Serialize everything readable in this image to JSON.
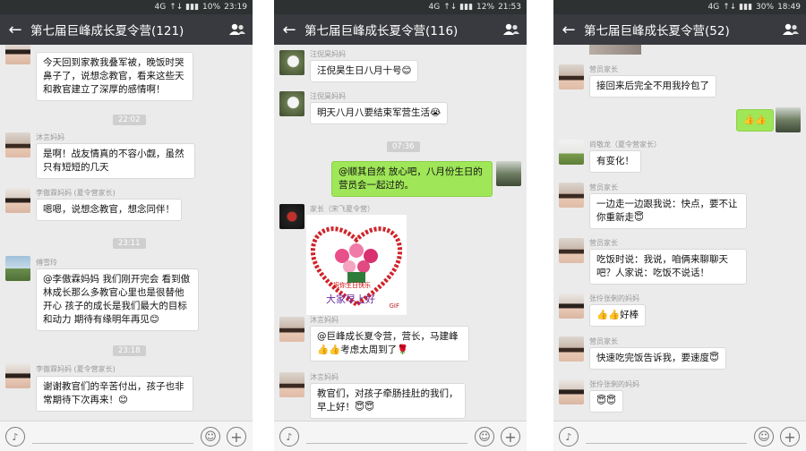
{
  "status_bars": [
    {
      "net": "4G",
      "signal": "↑↓ ▮▮▮",
      "battery": "10%",
      "time": "23:19"
    },
    {
      "net": "4G",
      "signal": "↑↓ ▮▮▮",
      "battery": "12%",
      "time": "21:53"
    },
    {
      "net": "4G",
      "signal": "↑↓ ▮▮▮",
      "battery": "30%",
      "time": "18:49"
    }
  ],
  "titles": [
    "第七届巨峰成长夏令营(121)",
    "第七届巨峰成长夏令营(116)",
    "第七届巨峰成长夏令营(52)"
  ],
  "icons": {
    "back": "back-arrow-icon",
    "group": "group-members-icon",
    "voice": "voice-icon",
    "emoji": "emoji-icon",
    "plus": "plus-icon"
  },
  "phone1": {
    "m1_text": "今天回到家教我叠军被，晚饭时哭鼻子了，说想念教官，看来这些天和教官建立了深厚的感情啊！",
    "t1": "22:02",
    "m2_name": "沐言妈妈",
    "m2_text": "是啊！战友情真的不容小觑，虽然只有短短的几天",
    "m3_name": "李傲霖妈妈 (夏令营家长)",
    "m3_text": "嗯嗯，说想念教官，想念同伴！",
    "t2": "23:11",
    "m4_name": "傅雪玲",
    "m4_text": "@李傲霖妈妈 我们刚开完会 看到傲林成长那么多教官心里也是很替他开心 孩子的成长是我们最大的目标和动力 期待有缘明年再见😊",
    "t3": "23:18",
    "m5_name": "李傲霖妈妈 (夏令营家长)",
    "m5_text": "谢谢教官们的辛苦付出，孩子也非常期待下次再来！😊"
  },
  "phone2": {
    "m1_name": "汪倪昊妈妈",
    "m1_text": "汪倪昊生日八月十号😊",
    "m2_name": "汪倪昊妈妈",
    "m2_text": "明天八月八要结束军营生活😭",
    "t1": "07:36",
    "m3_text": "@顺其自然 放心吧，八月份生日的营员会一起过的。",
    "m4_name": "家长（宋飞夏令营）",
    "img_text1": "祝你生日快乐",
    "img_text2": "大家早上好",
    "img_gif": "GIF",
    "m5_name": "沐言妈妈",
    "m5_text": "@巨峰成长夏令营，营长，马建峰👍👍考虑太周到了🌹",
    "m6_name": "沐言妈妈",
    "m6_text": "教官们，对孩子牵肠挂肚的我们，早上好！😇😇"
  },
  "phone3": {
    "m1_name": "营员家长",
    "m1_text": "接回来后完全不用我拎包了",
    "m2_text": "👍👍",
    "m3_name": "尚敬龙（夏令营家长）",
    "m3_text": "有变化！",
    "m4_name": "营员家长",
    "m4_text": "一边走一边跟我说：快点，要不让你重新走😇",
    "m5_name": "营员家长",
    "m5_text": "吃饭时说：我说，咱俩来聊聊天吧？人家说：吃饭不说话！",
    "m6_name": "张伶张俐的妈妈",
    "m6_text": "👍👍好棒",
    "m7_name": "营员家长",
    "m7_text": "快速吃完饭告诉我，要速度😇",
    "m8_name": "张伶张俐的妈妈",
    "m8_text": "😇😇"
  }
}
